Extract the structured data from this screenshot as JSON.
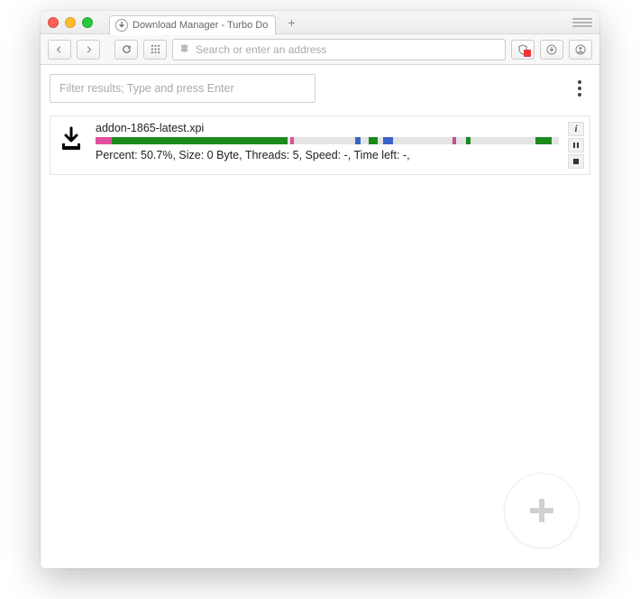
{
  "window": {
    "tab_title": "Download Manager - Turbo Do"
  },
  "toolbar": {
    "url_placeholder": "Search or enter an address"
  },
  "filter": {
    "placeholder": "Filter results; Type and press Enter"
  },
  "download": {
    "filename": "addon-1865-latest.xpi",
    "status_line": "Percent: 50.7%, Size: 0 Byte, Threads: 5, Speed: -, Time left: -,",
    "percent": 50.7,
    "segments": [
      {
        "start": 0,
        "width": 39,
        "color": "#1b8a1b"
      },
      {
        "start": 0,
        "width": 3.5,
        "color": "#e04f9e"
      },
      {
        "start": 39,
        "width": 2.5,
        "color": "#1b8a1b"
      },
      {
        "start": 42,
        "width": 0.8,
        "color": "#e04f9e"
      },
      {
        "start": 56,
        "width": 1.2,
        "color": "#3a63c8"
      },
      {
        "start": 59,
        "width": 1.8,
        "color": "#1b8a1b"
      },
      {
        "start": 62,
        "width": 2.2,
        "color": "#3a63c8"
      },
      {
        "start": 77,
        "width": 0.8,
        "color": "#c24f88"
      },
      {
        "start": 80,
        "width": 1.0,
        "color": "#1b8a1b"
      },
      {
        "start": 95,
        "width": 3.5,
        "color": "#1b8a1b"
      }
    ]
  }
}
